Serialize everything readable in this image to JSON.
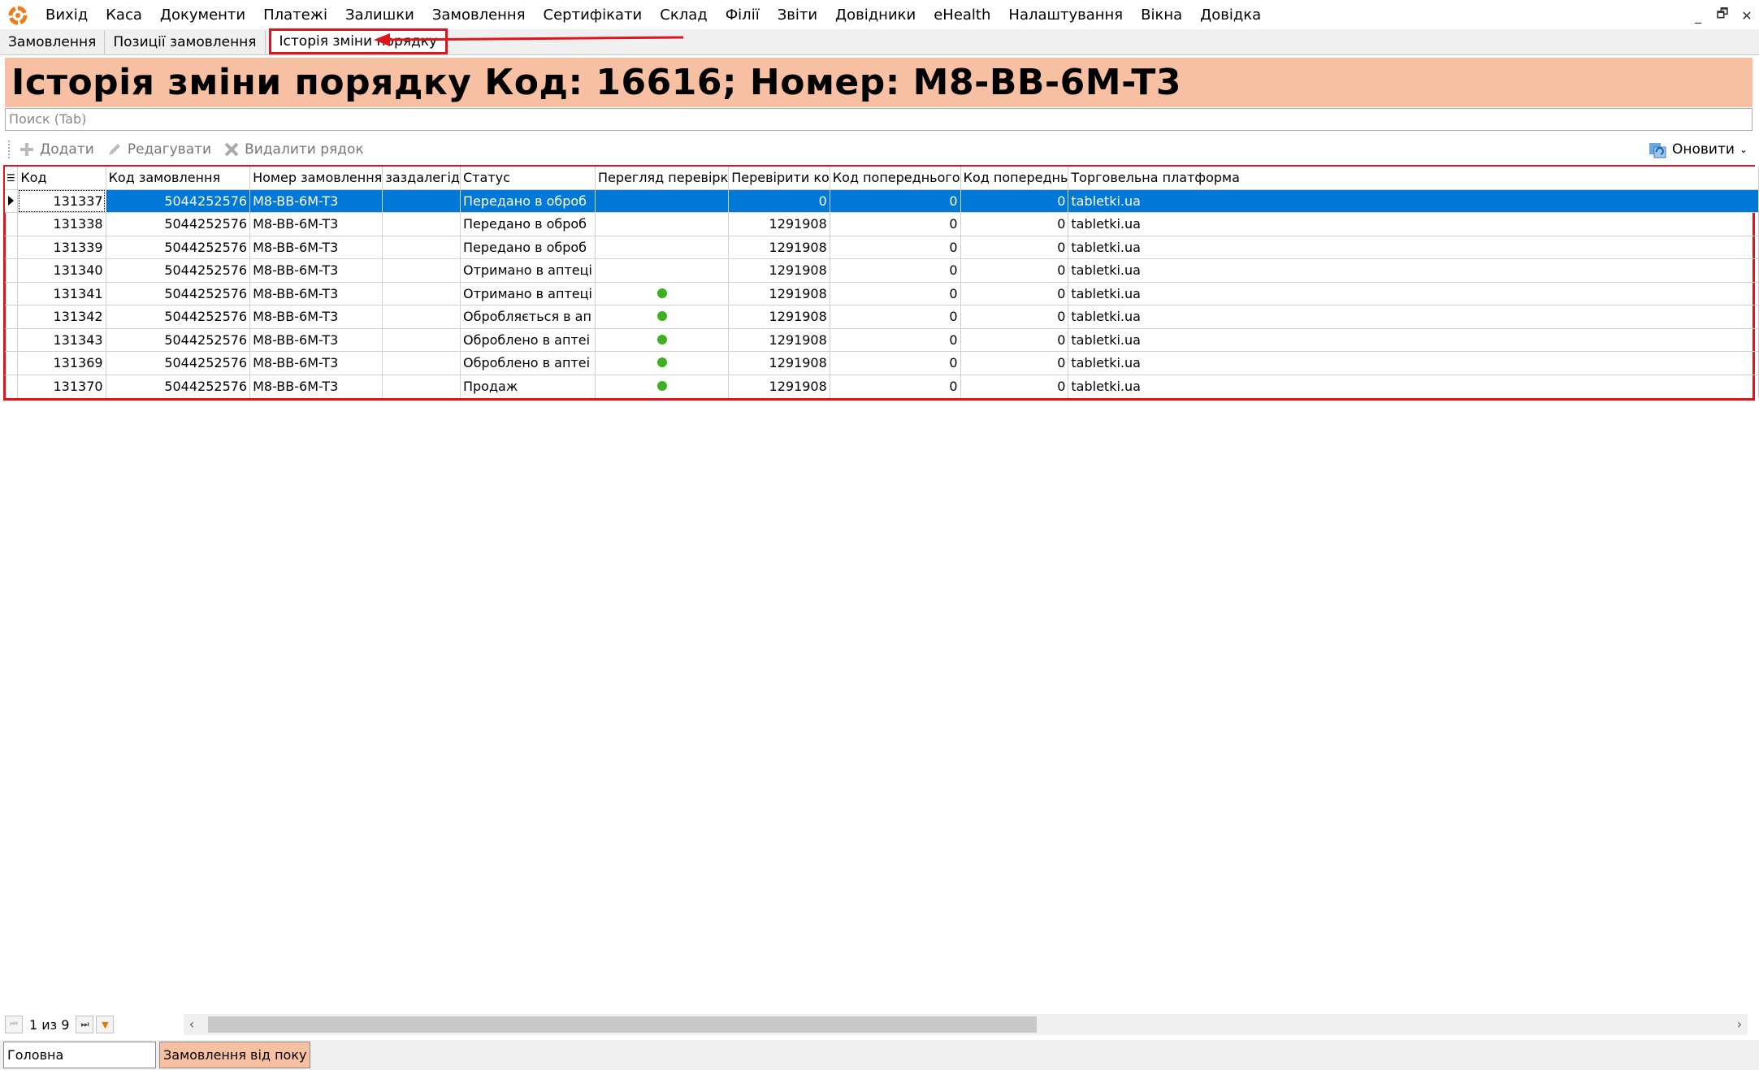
{
  "menu": {
    "items": [
      "Вихід",
      "Каса",
      "Документи",
      "Платежі",
      "Залишки",
      "Замовлення",
      "Сертифікати",
      "Склад",
      "Філії",
      "Звіти",
      "Довідники",
      "eHealth",
      "Налаштування",
      "Вікна",
      "Довідка"
    ],
    "window_controls": [
      "_",
      "🗗",
      "✕"
    ]
  },
  "tabs": [
    "Замовлення",
    "Позиції замовлення",
    "Історія зміни порядку"
  ],
  "page_title": "Історія зміни порядку Код: 16616; Номер: M8-BB-6M-T3",
  "search": {
    "placeholder": "Поиск (Tab)"
  },
  "toolbar": {
    "add": "Додати",
    "edit": "Редагувати",
    "delete": "Видалити рядок",
    "refresh": "Оновити"
  },
  "grid": {
    "columns": [
      "Код",
      "Код замовлення",
      "Номер замовлення",
      "заздалегід",
      "Статус",
      "Перегляд перевірк",
      "Перевірити ко",
      "Код попереднього",
      "Код попереднь",
      "Торговельна платформа"
    ],
    "rows": [
      {
        "kod": "131337",
        "order_code": "5044252576",
        "order_no": "M8-BB-6M-T3",
        "advance": "",
        "status": "Передано в оброб",
        "checked": false,
        "verify": "0",
        "prev1": "0",
        "prev2": "0",
        "platform": "tabletki.ua"
      },
      {
        "kod": "131338",
        "order_code": "5044252576",
        "order_no": "M8-BB-6M-T3",
        "advance": "",
        "status": "Передано в оброб",
        "checked": false,
        "verify": "1291908",
        "prev1": "0",
        "prev2": "0",
        "platform": "tabletki.ua"
      },
      {
        "kod": "131339",
        "order_code": "5044252576",
        "order_no": "M8-BB-6M-T3",
        "advance": "",
        "status": "Передано в оброб",
        "checked": false,
        "verify": "1291908",
        "prev1": "0",
        "prev2": "0",
        "platform": "tabletki.ua"
      },
      {
        "kod": "131340",
        "order_code": "5044252576",
        "order_no": "M8-BB-6M-T3",
        "advance": "",
        "status": "Отримано в аптеці",
        "checked": false,
        "verify": "1291908",
        "prev1": "0",
        "prev2": "0",
        "platform": "tabletki.ua"
      },
      {
        "kod": "131341",
        "order_code": "5044252576",
        "order_no": "M8-BB-6M-T3",
        "advance": "",
        "status": "Отримано в аптеці",
        "checked": true,
        "verify": "1291908",
        "prev1": "0",
        "prev2": "0",
        "platform": "tabletki.ua"
      },
      {
        "kod": "131342",
        "order_code": "5044252576",
        "order_no": "M8-BB-6M-T3",
        "advance": "",
        "status": "Обробляється в ап",
        "checked": true,
        "verify": "1291908",
        "prev1": "0",
        "prev2": "0",
        "platform": "tabletki.ua"
      },
      {
        "kod": "131343",
        "order_code": "5044252576",
        "order_no": "M8-BB-6M-T3",
        "advance": "",
        "status": "Оброблено в аптеі",
        "checked": true,
        "verify": "1291908",
        "prev1": "0",
        "prev2": "0",
        "platform": "tabletki.ua"
      },
      {
        "kod": "131369",
        "order_code": "5044252576",
        "order_no": "M8-BB-6M-T3",
        "advance": "",
        "status": "Оброблено в аптеі",
        "checked": true,
        "verify": "1291908",
        "prev1": "0",
        "prev2": "0",
        "platform": "tabletki.ua"
      },
      {
        "kod": "131370",
        "order_code": "5044252576",
        "order_no": "M8-BB-6M-T3",
        "advance": "",
        "status": "Продаж",
        "checked": true,
        "verify": "1291908",
        "prev1": "0",
        "prev2": "0",
        "platform": "tabletki.ua"
      }
    ],
    "selected_row": 0
  },
  "pager": {
    "count": "1 из 9"
  },
  "window_tabs": [
    "Головна",
    "Замовлення від поку ..."
  ],
  "colors": {
    "title_bg": "#f8c0a3",
    "selection": "#0078d7",
    "annotation_red": "#e0141b",
    "check_dot": "#3cb01f"
  }
}
